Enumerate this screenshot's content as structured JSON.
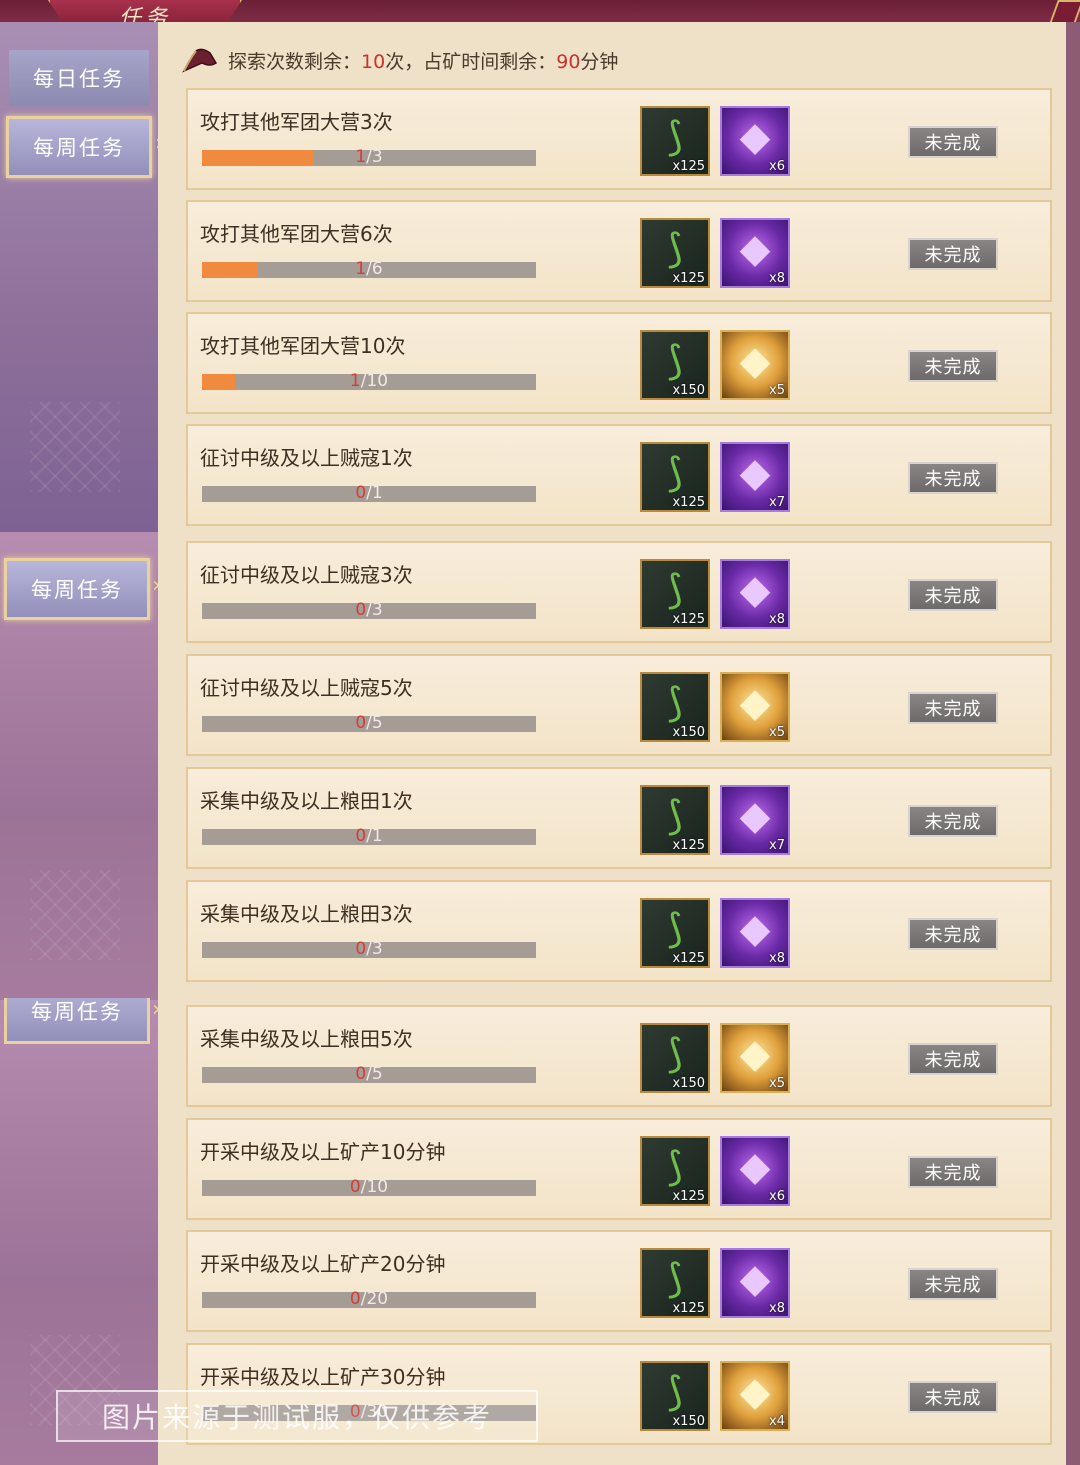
{
  "header": {
    "title": "任务"
  },
  "sidebar": {
    "tabs": [
      {
        "label": "每日任务"
      },
      {
        "label": "每周任务"
      }
    ],
    "repeat_labels": [
      "每周任务",
      "每周任务"
    ]
  },
  "info": {
    "explore_label": "探索次数剩余：",
    "explore_count": "10",
    "explore_unit": "次，",
    "mine_label": "占矿时间剩余：",
    "mine_time": "90",
    "mine_unit": "分钟"
  },
  "status_label": "未完成",
  "tasks": [
    {
      "title": "攻打其他军团大营3次",
      "current": "1",
      "total": "/3",
      "progress": 0.333,
      "reward1_qty": "x125",
      "reward2_type": "purple",
      "reward2_qty": "x6"
    },
    {
      "title": "攻打其他军团大营6次",
      "current": "1",
      "total": "/6",
      "progress": 0.167,
      "reward1_qty": "x125",
      "reward2_type": "purple",
      "reward2_qty": "x8"
    },
    {
      "title": "攻打其他军团大营10次",
      "current": "1",
      "total": "/10",
      "progress": 0.1,
      "reward1_qty": "x150",
      "reward2_type": "gold",
      "reward2_qty": "x5"
    },
    {
      "title": "征讨中级及以上贼寇1次",
      "current": "0",
      "total": "/1",
      "progress": 0,
      "reward1_qty": "x125",
      "reward2_type": "purple",
      "reward2_qty": "x7"
    },
    {
      "title": "征讨中级及以上贼寇3次",
      "current": "0",
      "total": "/3",
      "progress": 0,
      "reward1_qty": "x125",
      "reward2_type": "purple",
      "reward2_qty": "x8"
    },
    {
      "title": "征讨中级及以上贼寇5次",
      "current": "0",
      "total": "/5",
      "progress": 0,
      "reward1_qty": "x150",
      "reward2_type": "gold",
      "reward2_qty": "x5"
    },
    {
      "title": "采集中级及以上粮田1次",
      "current": "0",
      "total": "/1",
      "progress": 0,
      "reward1_qty": "x125",
      "reward2_type": "purple",
      "reward2_qty": "x7"
    },
    {
      "title": "采集中级及以上粮田3次",
      "current": "0",
      "total": "/3",
      "progress": 0,
      "reward1_qty": "x125",
      "reward2_type": "purple",
      "reward2_qty": "x8"
    },
    {
      "title": "采集中级及以上粮田5次",
      "current": "0",
      "total": "/5",
      "progress": 0,
      "reward1_qty": "x150",
      "reward2_type": "gold",
      "reward2_qty": "x5"
    },
    {
      "title": "开采中级及以上矿产10分钟",
      "current": "0",
      "total": "/10",
      "progress": 0,
      "reward1_qty": "x125",
      "reward2_type": "purple",
      "reward2_qty": "x6"
    },
    {
      "title": "开采中级及以上矿产20分钟",
      "current": "0",
      "total": "/20",
      "progress": 0,
      "reward1_qty": "x125",
      "reward2_type": "purple",
      "reward2_qty": "x8"
    },
    {
      "title": "开采中级及以上矿产30分钟",
      "current": "0",
      "total": "/30",
      "progress": 0,
      "reward1_qty": "x150",
      "reward2_type": "gold",
      "reward2_qty": "x4"
    }
  ],
  "watermark": "图片来源于测试服，仅供参考"
}
